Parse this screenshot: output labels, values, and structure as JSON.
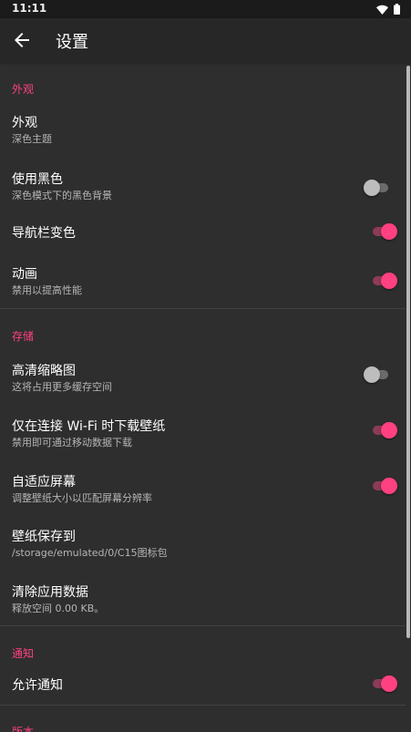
{
  "status": {
    "time": "11:11",
    "icons": [
      "wifi-icon",
      "battery-icon"
    ]
  },
  "appbar": {
    "title": "设置",
    "back_icon": "arrow-back-icon"
  },
  "colors": {
    "accent": "#ff4081",
    "background": "#2e2e2e",
    "appbar": "#272727"
  },
  "sections": {
    "appearance": {
      "header": "外观",
      "theme": {
        "title": "外观",
        "subtitle": "深色主题"
      },
      "black": {
        "title": "使用黑色",
        "subtitle": "深色模式下的黑色背景",
        "enabled": false
      },
      "navbar": {
        "title": "导航栏变色",
        "enabled": true
      },
      "animation": {
        "title": "动画",
        "subtitle": "禁用以提高性能",
        "enabled": true
      }
    },
    "storage": {
      "header": "存储",
      "hd_thumbs": {
        "title": "高清缩略图",
        "subtitle": "这将占用更多缓存空间",
        "enabled": false
      },
      "wifi_only": {
        "title": "仅在连接 Wi-Fi 时下载壁纸",
        "subtitle": "禁用即可通过移动数据下载",
        "enabled": true
      },
      "adaptive": {
        "title": "自适应屏幕",
        "subtitle": "调整壁纸大小以匹配屏幕分辨率",
        "enabled": true
      },
      "save_path": {
        "title": "壁纸保存到",
        "subtitle": "/storage/emulated/0/C15图标包"
      },
      "clear_data": {
        "title": "清除应用数据",
        "subtitle": "释放空间 0.00 KB。"
      }
    },
    "notification": {
      "header": "通知",
      "allow": {
        "title": "允许通知",
        "enabled": true
      }
    },
    "version": {
      "header": "版本"
    }
  }
}
